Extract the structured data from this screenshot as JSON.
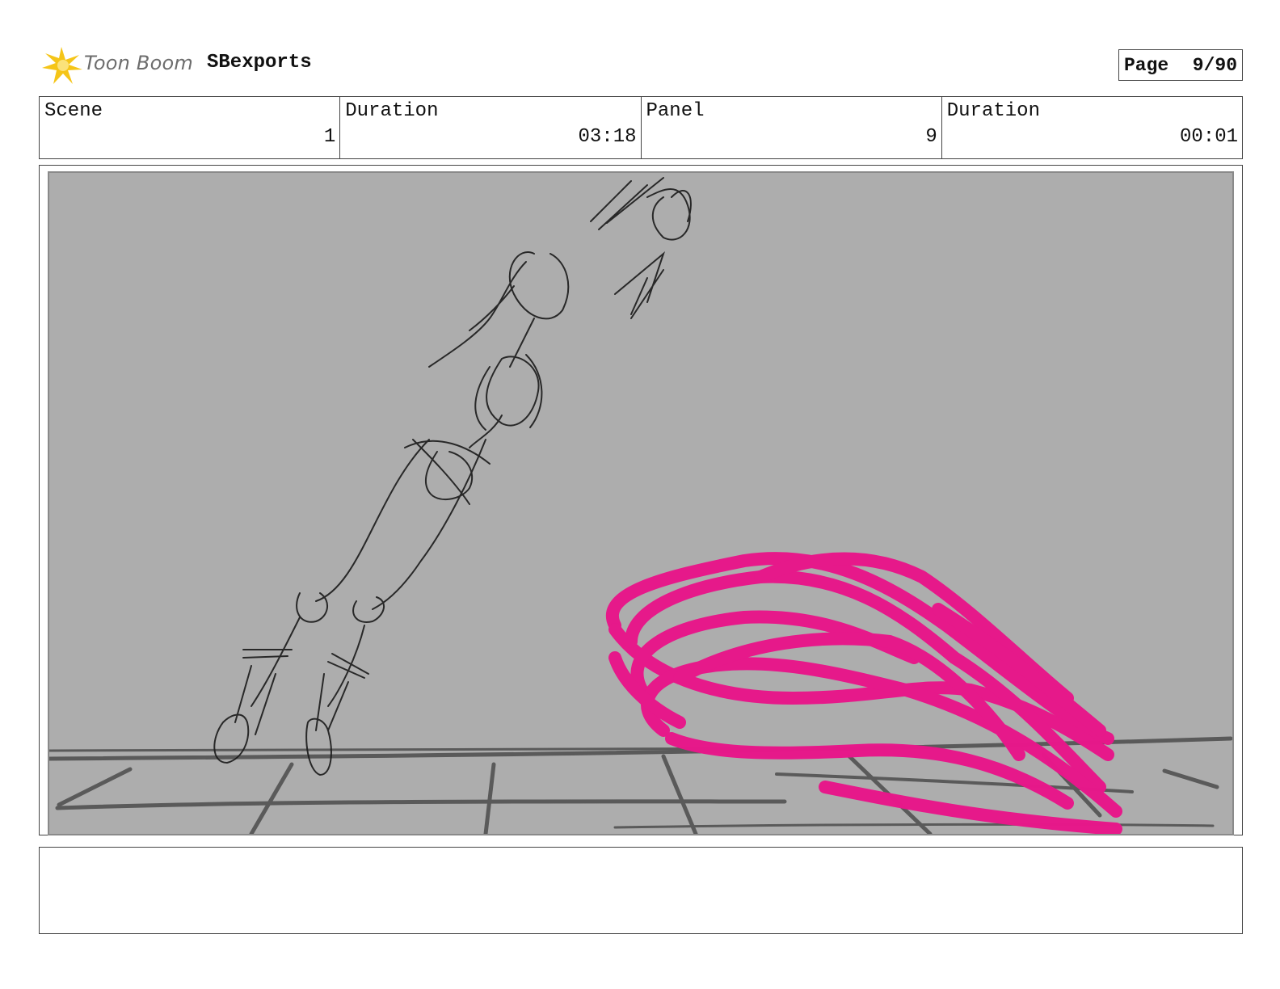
{
  "header": {
    "brand": "Toon Boom",
    "project_title": "SBexports",
    "page_label": "Page",
    "page_value": "9/90"
  },
  "info": [
    {
      "label": "Scene",
      "value": "1"
    },
    {
      "label": "Duration",
      "value": "03:18"
    },
    {
      "label": "Panel",
      "value": "9"
    },
    {
      "label": "Duration",
      "value": "00:01"
    }
  ],
  "colors": {
    "logo_star": "#f5c518",
    "panel_bg": "#adadad",
    "sketch_line": "#1a1a1a",
    "floor_line": "#5a5a5a",
    "scribble": "#e8178a"
  },
  "notes": ""
}
